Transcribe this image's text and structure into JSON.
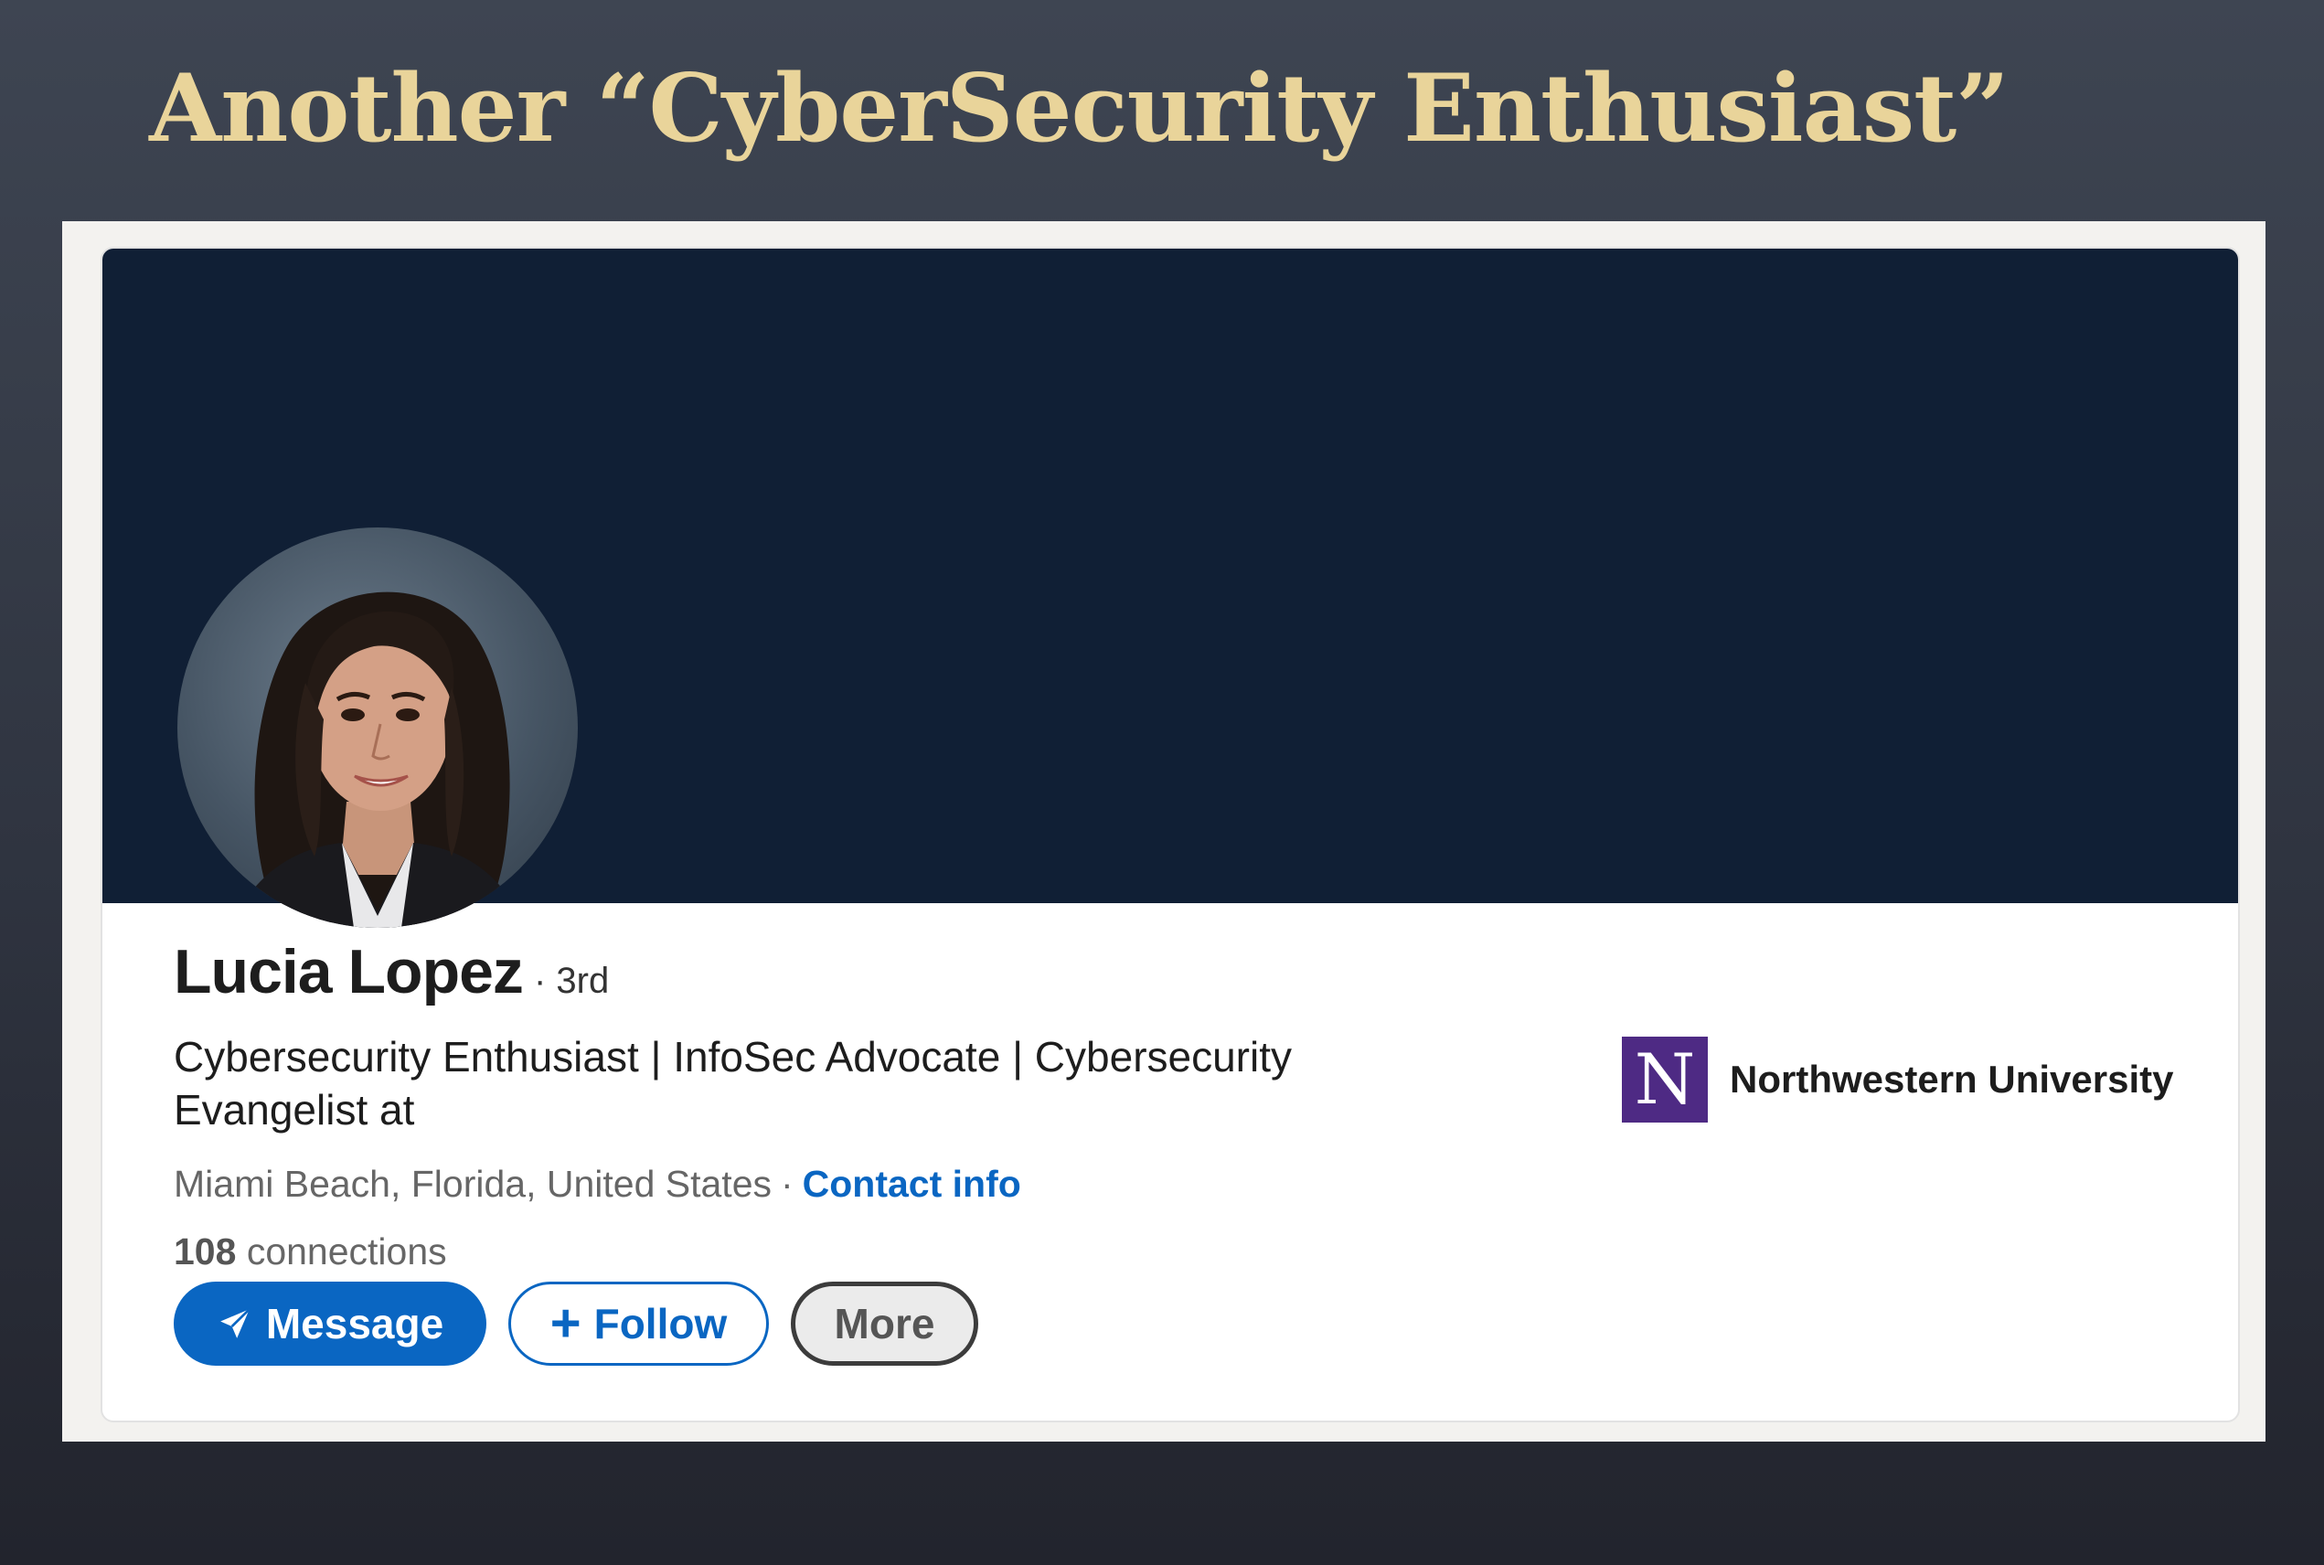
{
  "slide": {
    "title": "Another “CyberSecurity Enthusiast”"
  },
  "profile": {
    "name": "Lucia Lopez",
    "degree": "· 3rd",
    "headline": "Cybersecurity Enthusiast | InfoSec Advocate | Cybersecurity Evangelist at",
    "location": "Miami Beach, Florida, United States",
    "location_separator": "·",
    "contact_info_label": "Contact info",
    "connections_count": "108",
    "connections_label": "connections"
  },
  "actions": {
    "message_label": "Message",
    "follow_label": "Follow",
    "follow_icon": "+",
    "more_label": "More"
  },
  "education": {
    "logo_letter": "N",
    "school_name": "Northwestern University"
  },
  "colors": {
    "banner": "#101f35",
    "linkedin_blue": "#0a66c2",
    "northwestern_purple": "#4e2a84",
    "title_gold": "#e9d49a"
  },
  "icons": {
    "message": "send-icon",
    "follow": "plus-icon"
  }
}
